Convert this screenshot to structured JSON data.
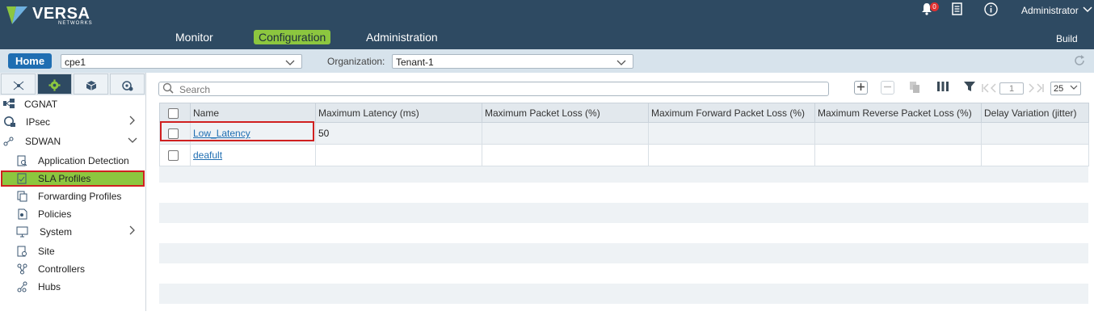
{
  "header": {
    "brand": "VERSA",
    "brand_sub": "NETWORKS",
    "notification_count": "0",
    "user_label": "Administrator",
    "nav": [
      {
        "label": "Monitor"
      },
      {
        "label": "Configuration"
      },
      {
        "label": "Administration"
      }
    ],
    "build_label": "Build"
  },
  "toolbar": {
    "home_label": "Home",
    "appliance_value": "cpe1",
    "org_label": "Organization:",
    "org_value": "Tenant-1"
  },
  "sidebar": {
    "tabs": [
      "network-icon",
      "gear-icon",
      "cube-icon",
      "settings-icon"
    ],
    "items": [
      {
        "label": "CGNAT",
        "icon": "nat-icon"
      },
      {
        "label": "IPsec",
        "icon": "lock-globe-icon"
      },
      {
        "label": "SDWAN",
        "icon": "sdwan-icon"
      },
      {
        "label": "Application Detection",
        "icon": "detect-icon"
      },
      {
        "label": "SLA Profiles",
        "icon": "sla-icon"
      },
      {
        "label": "Forwarding Profiles",
        "icon": "forward-icon"
      },
      {
        "label": "Policies",
        "icon": "policy-icon"
      },
      {
        "label": "System",
        "icon": "system-icon"
      },
      {
        "label": "Site",
        "icon": "site-icon"
      },
      {
        "label": "Controllers",
        "icon": "controllers-icon"
      },
      {
        "label": "Hubs",
        "icon": "hubs-icon"
      }
    ]
  },
  "grid": {
    "search_placeholder": "Search",
    "page_number": "1",
    "page_size": "25",
    "columns": [
      "Name",
      "Maximum Latency (ms)",
      "Maximum Packet Loss (%)",
      "Maximum Forward Packet Loss (%)",
      "Maximum Reverse Packet Loss (%)",
      "Delay Variation (jitter)"
    ],
    "rows": [
      {
        "name": "Low_Latency",
        "max_latency": "50",
        "max_packet_loss": "",
        "max_fwd_loss": "",
        "max_rev_loss": "",
        "jitter": ""
      },
      {
        "name": "deafult",
        "max_latency": "",
        "max_packet_loss": "",
        "max_fwd_loss": "",
        "max_rev_loss": "",
        "jitter": ""
      }
    ]
  },
  "colors": {
    "header_bg": "#2e4a62",
    "accent_green": "#8cc63f",
    "home_blue": "#1f6eb2",
    "highlight_red": "#d02020"
  }
}
